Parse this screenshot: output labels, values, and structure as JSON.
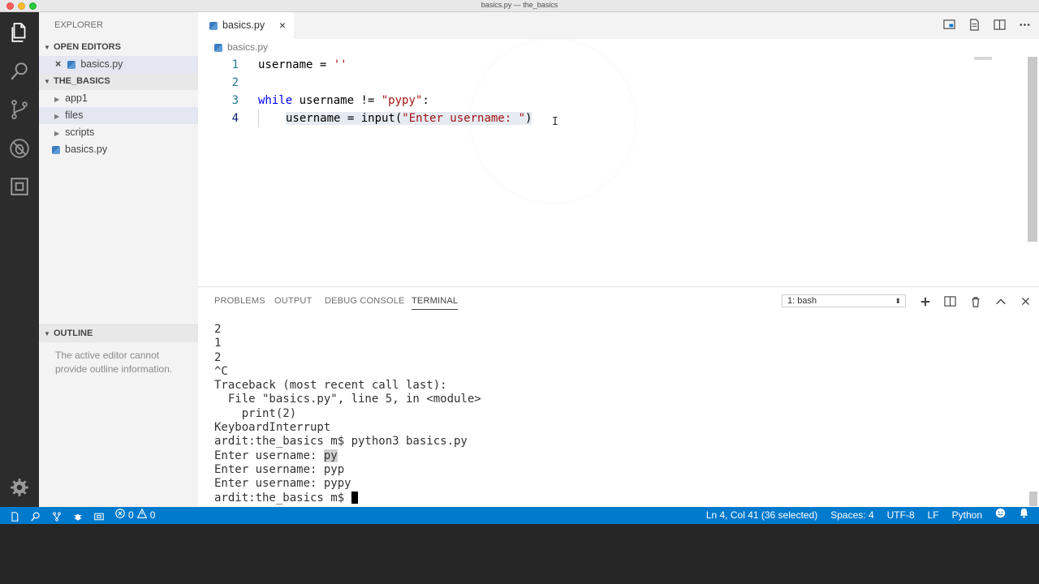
{
  "window": {
    "title": "basics.py — the_basics"
  },
  "activity_bar": {
    "icons": [
      "files-icon",
      "search-icon",
      "source-control-icon",
      "debug-icon",
      "extensions-icon",
      "gear-icon"
    ]
  },
  "sidebar": {
    "header": "EXPLORER",
    "open_editors": {
      "label": "OPEN EDITORS",
      "items": [
        {
          "close": "×",
          "label": "basics.py"
        }
      ]
    },
    "project": {
      "label": "THE_BASICS",
      "items": [
        {
          "label": "app1",
          "type": "folder"
        },
        {
          "label": "files",
          "type": "folder"
        },
        {
          "label": "scripts",
          "type": "folder"
        },
        {
          "label": "basics.py",
          "type": "python-file"
        }
      ]
    },
    "outline": {
      "label": "OUTLINE",
      "message": "The active editor cannot provide outline information."
    }
  },
  "editor": {
    "tab": {
      "label": "basics.py",
      "close": "×"
    },
    "breadcrumb": "basics.py",
    "line_numbers": [
      "1",
      "2",
      "3",
      "4"
    ],
    "lines": {
      "l1": {
        "a": "username = ",
        "b": "''"
      },
      "l3": {
        "kw": "while",
        "a": " username != ",
        "b": "\"pypy\"",
        "c": ":"
      },
      "l4": {
        "a": "username = input(",
        "b": "\"Enter username: \"",
        "c": ")"
      }
    }
  },
  "panel": {
    "tabs": [
      "PROBLEMS",
      "OUTPUT",
      "DEBUG CONSOLE",
      "TERMINAL"
    ],
    "active_tab": "TERMINAL",
    "terminal_select": "1: bash",
    "terminal_lines": [
      "2",
      "1",
      "2",
      "^C",
      "Traceback (most recent call last):",
      "  File \"basics.py\", line 5, in <module>",
      "    print(2)",
      "KeyboardInterrupt",
      "ardit:the_basics m$ python3 basics.py"
    ],
    "prompt_line": {
      "prefix": "Enter username: ",
      "typed": "py"
    },
    "more_lines": [
      "Enter username: pyp",
      "Enter username: pypy"
    ],
    "final_prompt": "ardit:the_basics m$ "
  },
  "statusbar": {
    "errors": "0",
    "warnings": "0",
    "position": "Ln 4, Col 41 (36 selected)",
    "spaces": "Spaces: 4",
    "encoding": "UTF-8",
    "eol": "LF",
    "language": "Python"
  },
  "colors": {
    "accent": "#007acc",
    "keyword": "#0000ff",
    "string": "#a31515",
    "activity_bg": "#2c2c2c"
  }
}
